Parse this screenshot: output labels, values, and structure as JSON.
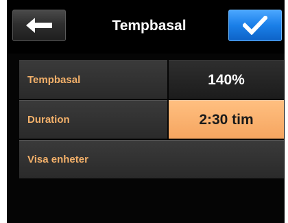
{
  "header": {
    "title": "Tempbasal",
    "back_icon": "arrow-left-icon",
    "ok_icon": "checkmark-icon"
  },
  "rows": [
    {
      "label": "Tempbasal",
      "value": "140%"
    },
    {
      "label": "Duration",
      "value": "2:30 tim"
    },
    {
      "label": "Visa enheter"
    }
  ],
  "colors": {
    "accent_label": "#f2b06a",
    "selected_value_bg": "#ffbf80",
    "ok_button": "#1a7fe8"
  }
}
